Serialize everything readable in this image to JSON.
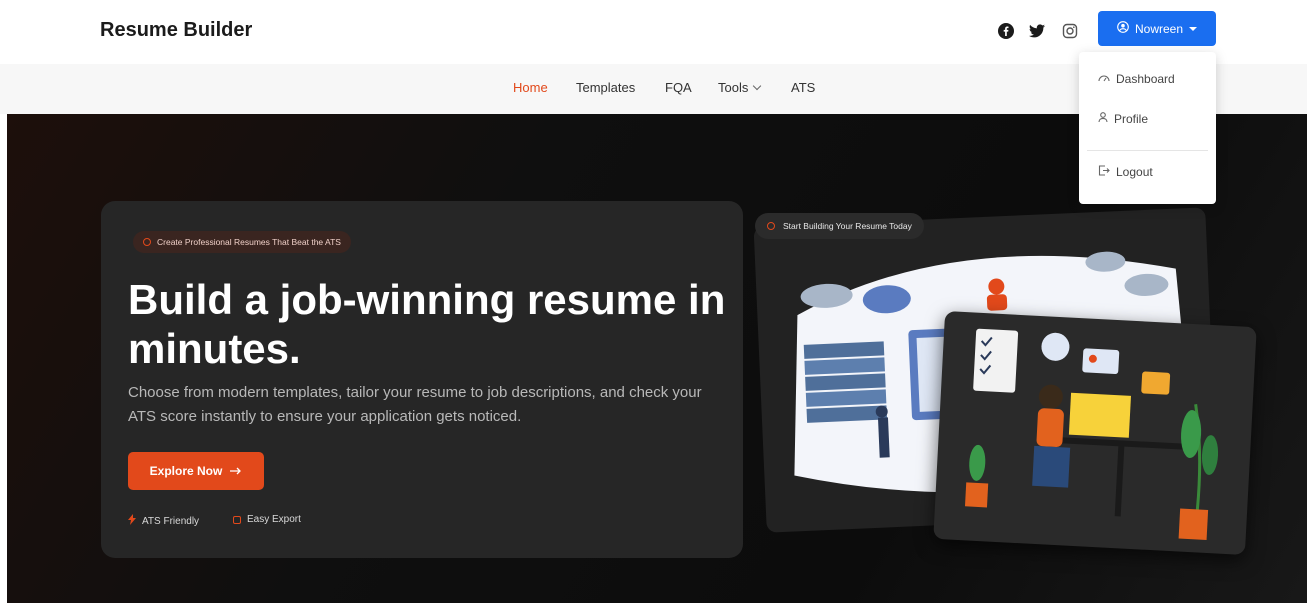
{
  "brand": "Resume Builder",
  "user_menu": {
    "label": "Nowreen",
    "items": [
      {
        "label": "Dashboard",
        "icon": "gauge-icon"
      },
      {
        "label": "Profile",
        "icon": "user-icon"
      },
      {
        "label": "Logout",
        "icon": "logout-icon"
      }
    ]
  },
  "social": [
    {
      "name": "facebook-icon"
    },
    {
      "name": "twitter-icon"
    },
    {
      "name": "instagram-icon"
    }
  ],
  "nav": {
    "items": [
      {
        "label": "Home",
        "active": true
      },
      {
        "label": "Templates"
      },
      {
        "label": "FQA"
      },
      {
        "label": "Tools",
        "has_dropdown": true
      },
      {
        "label": "ATS"
      }
    ]
  },
  "hero": {
    "badge": "Create Professional Resumes That Beat the ATS",
    "headline": "Build a job-winning resume in minutes.",
    "description": "Choose from modern templates, tailor your resume to job descriptions, and check your ATS score instantly to ensure your application gets noticed.",
    "cta_label": "Explore Now",
    "features": [
      "ATS Friendly",
      "Easy Export"
    ],
    "illustration_badge": "Start Building Your Resume Today"
  },
  "colors": {
    "accent": "#e2491b",
    "primary_button": "#1a6ef0",
    "hero_bg": "#0f0f0f",
    "card_bg": "#262626"
  }
}
